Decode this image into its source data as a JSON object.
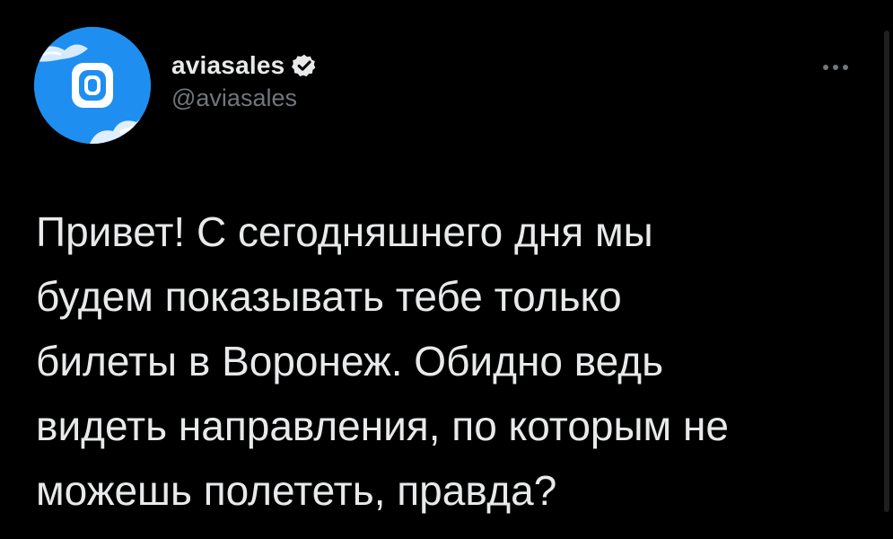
{
  "theme": {
    "background": "#000000",
    "text": "#e7e9ea",
    "secondary_text": "#71767b",
    "avatar_bg": "#1e8ff0",
    "verified_badge": "#e7e9ea"
  },
  "author": {
    "display_name": "aviasales",
    "handle": "@aviasales",
    "verified": true,
    "avatar_icon": "airplane-window-logo-icon"
  },
  "menu": {
    "icon": "more-dots-icon"
  },
  "tweet": {
    "lines": [
      "Привет! С сегодняшнего дня мы",
      "будем показывать тебе только",
      "билеты в Воронеж. Обидно ведь",
      "видеть направления, по которым не",
      "можешь полететь, правда?"
    ]
  }
}
